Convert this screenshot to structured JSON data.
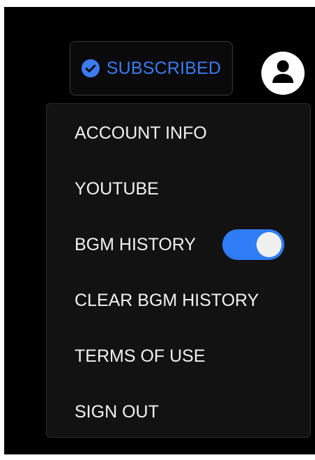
{
  "header": {
    "subscribe_button": {
      "label": "SUBSCRIBED",
      "icon": "check-circle-icon",
      "state": "subscribed"
    },
    "avatar_icon": "user-avatar-icon"
  },
  "menu": {
    "items": [
      {
        "label": "ACCOUNT INFO"
      },
      {
        "label": "YOUTUBE"
      },
      {
        "label": "BGM HISTORY",
        "toggle": {
          "on": true
        }
      },
      {
        "label": "CLEAR BGM HISTORY"
      },
      {
        "label": "TERMS OF USE"
      },
      {
        "label": "SIGN OUT"
      }
    ]
  },
  "colors": {
    "accent": "#3b7bf0",
    "toggle_on": "#2f7cf6",
    "background": "#000000",
    "menu_background": "#121212",
    "menu_text": "#f2f2f2"
  }
}
